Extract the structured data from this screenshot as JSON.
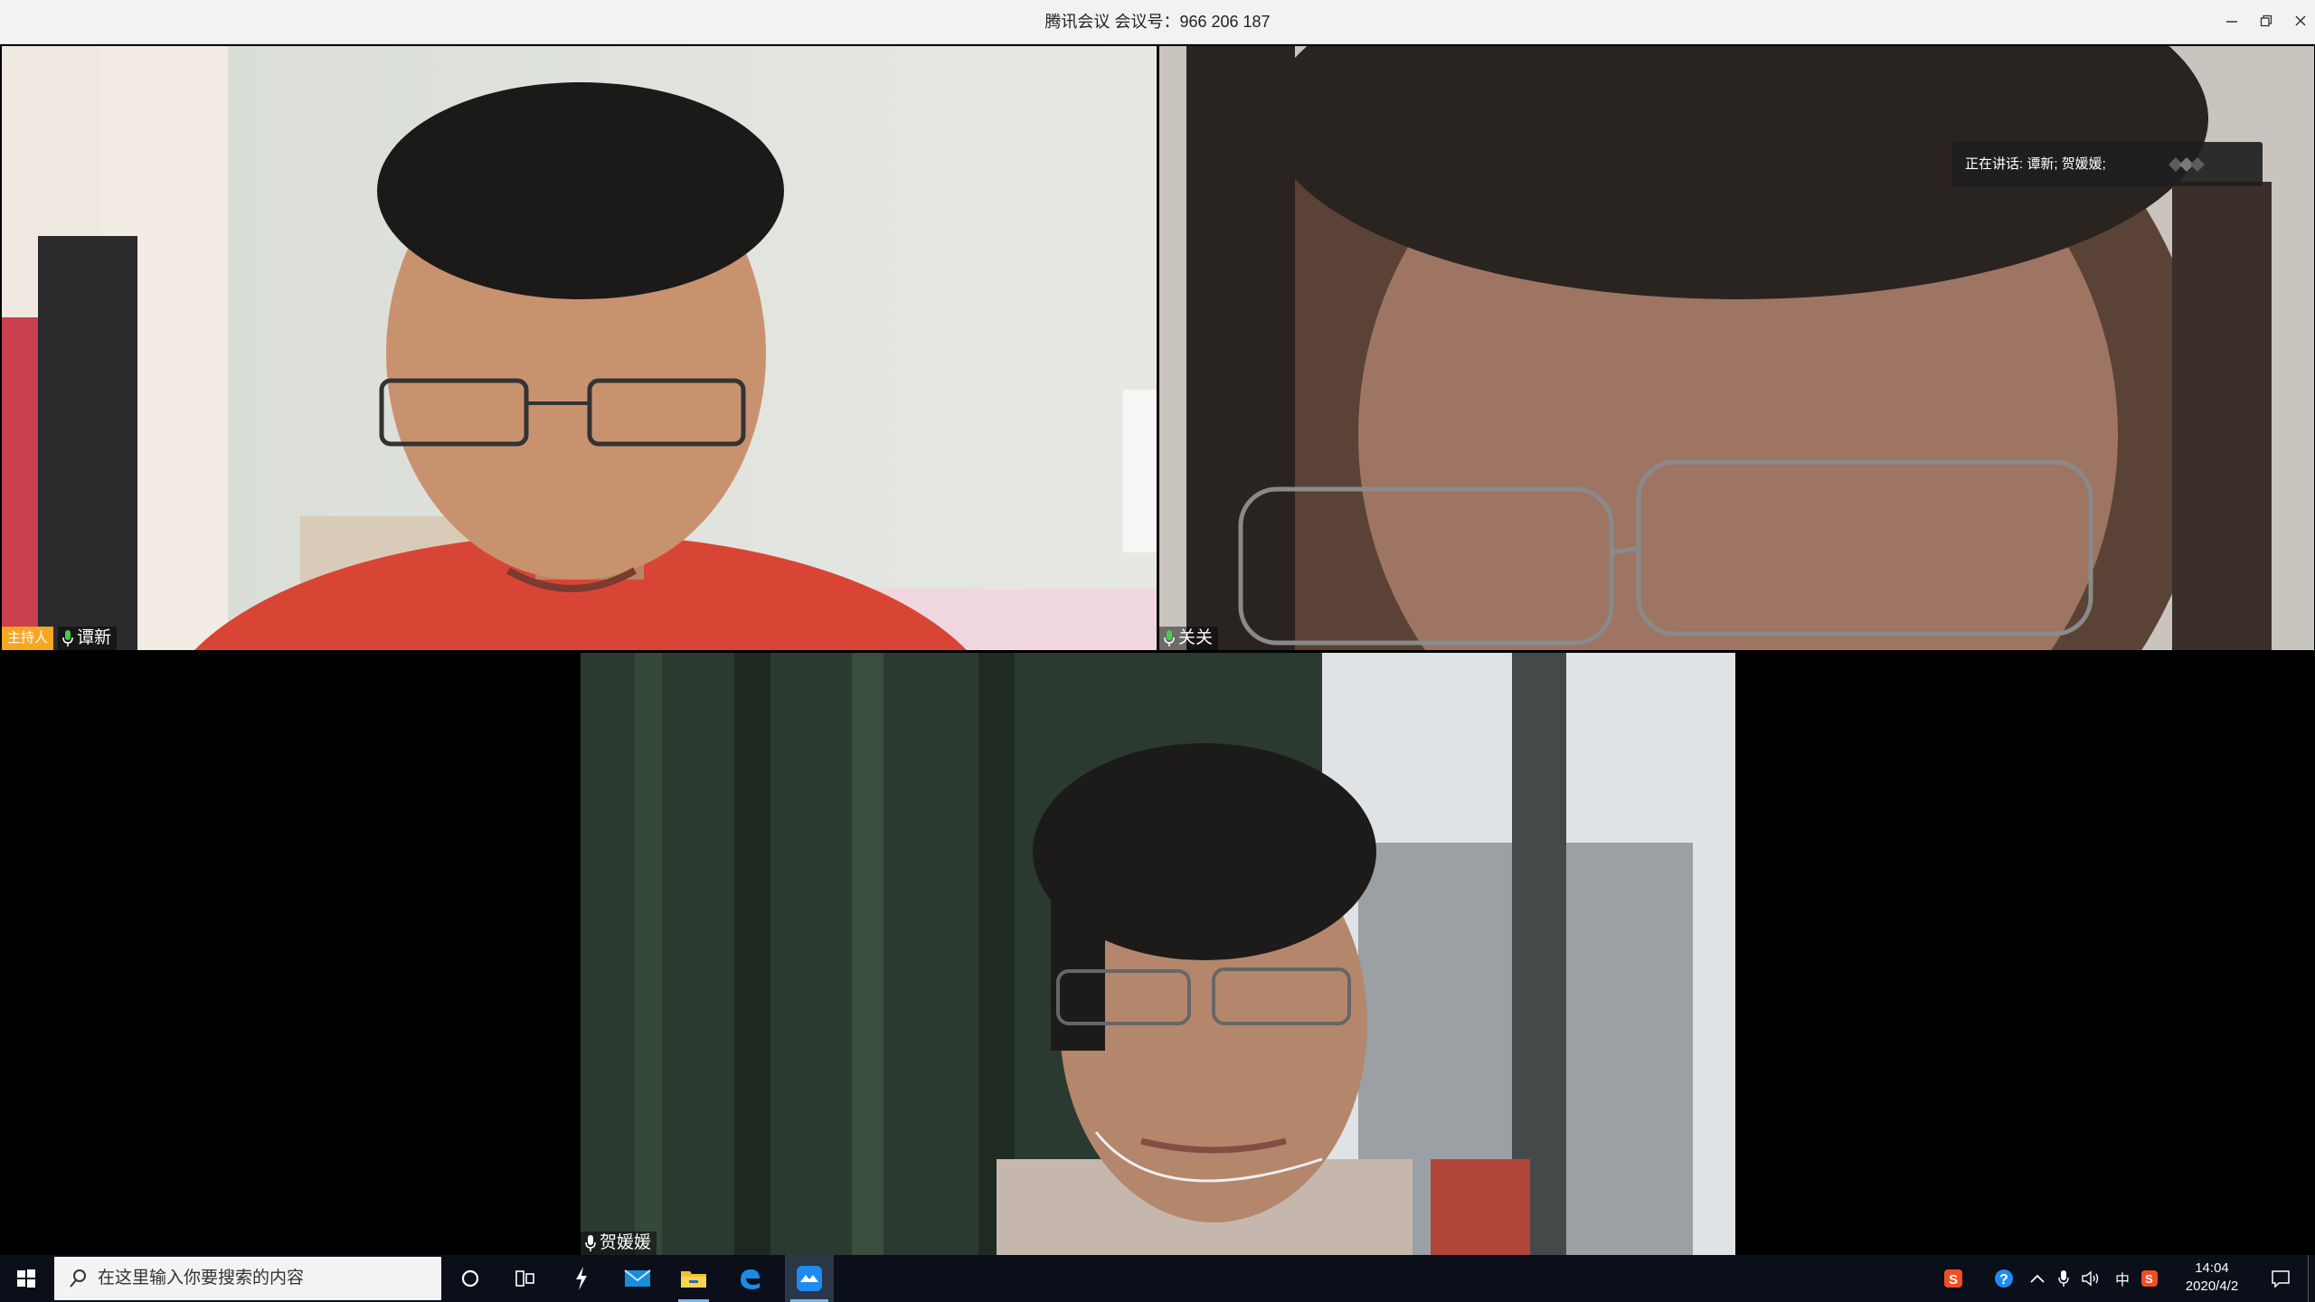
{
  "window": {
    "title": "腾讯会议 会议号：966 206 187",
    "minimize_icon": "minimize-icon",
    "restore_icon": "restore-icon",
    "close_icon": "close-icon"
  },
  "participants": [
    {
      "name": "谭新",
      "host_badge": "主持人",
      "mic": "unmuted"
    },
    {
      "name": "关关",
      "mic": "unmuted"
    },
    {
      "name": "贺媛媛",
      "mic": "unmuted"
    }
  ],
  "speaking_indicator": {
    "text": "正在讲话: 谭新; 贺媛媛;"
  },
  "taskbar": {
    "search_placeholder": "在这里输入你要搜索的内容",
    "clock_time": "14:04",
    "clock_date": "2020/4/2",
    "ime_label": "中",
    "colors": {
      "background": "#0a0f1a",
      "accent": "#76b9ed"
    }
  }
}
